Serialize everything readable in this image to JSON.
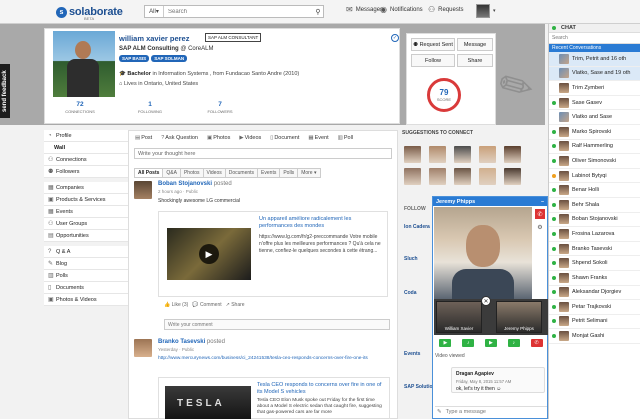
{
  "brand": {
    "logo_text": "solaborate",
    "beta": "BETA"
  },
  "search": {
    "scope": "All",
    "placeholder": "Search"
  },
  "topnav": {
    "messages": "Messages",
    "notifications": "Notifications",
    "requests": "Requests"
  },
  "feedback": "send feedback",
  "profile": {
    "name": "william xavier perez",
    "badge": "SAP ALM CONSULTANT",
    "headline_title": "SAP ALM Consulting",
    "headline_company": "@ CoreALM",
    "tags": [
      "SAP BASIS",
      "SAP SOLMAN"
    ],
    "education_degree": "Bachelor",
    "education_rest": "in Information Systems , from Fundacao Santo Andre (2010)",
    "location": "Lives in Ontario, United States",
    "stats": [
      {
        "value": "72",
        "label": "CONNECTIONS"
      },
      {
        "value": "1",
        "label": "FOLLOWING"
      },
      {
        "value": "7",
        "label": "FOLLOWERS"
      }
    ]
  },
  "actions": {
    "request": "Request Sent",
    "message": "Message",
    "follow": "Follow",
    "share": "Share",
    "score_value": "79",
    "score_label": "SCORE"
  },
  "leftnav": [
    {
      "label": "Profile",
      "icon": "person-icon",
      "type": "normal"
    },
    {
      "label": "Wall",
      "icon": "",
      "type": "active"
    },
    {
      "label": "Connections",
      "icon": "connections-icon",
      "type": "normal"
    },
    {
      "label": "Followers",
      "icon": "followers-icon",
      "type": "normal"
    },
    {
      "label": "Companies",
      "icon": "building-icon",
      "type": "normal"
    },
    {
      "label": "Products & Services",
      "icon": "box-icon",
      "type": "normal"
    },
    {
      "label": "Events",
      "icon": "calendar-icon",
      "type": "normal"
    },
    {
      "label": "User Groups",
      "icon": "group-icon",
      "type": "normal"
    },
    {
      "label": "Opportunities",
      "icon": "briefcase-icon",
      "type": "normal"
    },
    {
      "label": "Q & A",
      "icon": "question-icon",
      "type": "normal"
    },
    {
      "label": "Blog",
      "icon": "blog-icon",
      "type": "normal"
    },
    {
      "label": "Polls",
      "icon": "poll-icon",
      "type": "normal"
    },
    {
      "label": "Documents",
      "icon": "document-icon",
      "type": "normal"
    },
    {
      "label": "Photos & Videos",
      "icon": "photo-icon",
      "type": "normal"
    }
  ],
  "feed": {
    "post_tabs": [
      "Post",
      "Ask Question",
      "Photos",
      "Videos",
      "Document",
      "Event",
      "Poll"
    ],
    "thought_placeholder": "Write your thought here",
    "filters": [
      "All Posts",
      "Q&A",
      "Photos",
      "Videos",
      "Documents",
      "Events",
      "Polls",
      "More"
    ],
    "post1": {
      "author": "Boban Stojanovski",
      "verb": "posted",
      "time": "2 hours ago · Public",
      "text": "Shockingly awesome LG commercial",
      "link_title": "Un appareil améliore radicalement les performances des mondes",
      "link_desc": "https://www.lg.com/fr/g2-preccommande Votre mobile n'offre plus les meilleures performances ? Qu'à cela ne tienne, confiez-le quelques secondes à cette étrang...",
      "like": "Like (3)",
      "comment": "Comment",
      "share": "Share",
      "comment_placeholder": "Write your comment"
    },
    "post2": {
      "author": "Branko Tasevski",
      "verb": "posted",
      "time": "Yesterday · Public",
      "link": "http://www.mercurynews.com/business/ci_24241538/tesla-ceo-responds-concerns-over-fire-one-its",
      "image_text": "TESLA",
      "title": "Tesla CEO responds to concerns over fire in one of its Model S vehicles",
      "desc": "Tesla CEO Elon Musk spoke out Friday for the first time about a Model S electric sedan that caught fire, suggesting that gas-powered cars are far more"
    }
  },
  "suggestions": {
    "heading": "SUGGESTIONS TO CONNECT",
    "follow_heading": "FOLLOW",
    "items": [
      "Ion Cadera",
      "Sluch",
      "Coda",
      "Events",
      "SAP Solution"
    ]
  },
  "chat_window": {
    "name": "Jeremy Phipps",
    "tile1": "William Xavier",
    "tile2": "Jeremy Phipps",
    "notice": "Video viewed",
    "msg_name": "Dragan Agapiev",
    "msg_time": "Friday, May 8, 2015 11:57 AM",
    "msg_text": "ok, let's try it then",
    "input_placeholder": "Type a message"
  },
  "chat_panel": {
    "title": "CHAT",
    "search_placeholder": "Search",
    "recent": "Recent Conversations",
    "contacts": [
      {
        "name": "Trim, Petrit and 16 oth",
        "status": "group",
        "hl": true
      },
      {
        "name": "Vlatko, Sase and 19 oth",
        "status": "group",
        "hl": true
      },
      {
        "name": "Trim Zymberi",
        "status": "none",
        "hl": false
      },
      {
        "name": "Sase Gasev",
        "status": "online",
        "hl": false
      },
      {
        "name": "Vlatko and Sase",
        "status": "group",
        "hl": false
      },
      {
        "name": "Marko Spirovski",
        "status": "online",
        "hl": false
      },
      {
        "name": "Ralf Hammerling",
        "status": "online",
        "hl": false
      },
      {
        "name": "Oliver Simonovski",
        "status": "online",
        "hl": false
      },
      {
        "name": "Labinot Bytyqi",
        "status": "away",
        "hl": false
      },
      {
        "name": "Benar Holli",
        "status": "online",
        "hl": false
      },
      {
        "name": "Behr Shala",
        "status": "online",
        "hl": false
      },
      {
        "name": "Boban Stojanovski",
        "status": "online",
        "hl": false
      },
      {
        "name": "Frosina Lazarova",
        "status": "online",
        "hl": false
      },
      {
        "name": "Branko Tasevski",
        "status": "online",
        "hl": false
      },
      {
        "name": "Shpend Sokoli",
        "status": "online",
        "hl": false
      },
      {
        "name": "Shawn Franks",
        "status": "online",
        "hl": false
      },
      {
        "name": "Aleksandar Djorgiev",
        "status": "online",
        "hl": false
      },
      {
        "name": "Petar Trajkovski",
        "status": "online",
        "hl": false
      },
      {
        "name": "Petrit Selimani",
        "status": "online",
        "hl": false
      },
      {
        "name": "Monjat Gashi",
        "status": "online",
        "hl": false
      }
    ]
  },
  "colors": {
    "brand": "#1d4f91",
    "accent": "#2a7bd4",
    "online": "#2fb244",
    "score_ring": "#d93a3a",
    "away": "#f0a020"
  }
}
